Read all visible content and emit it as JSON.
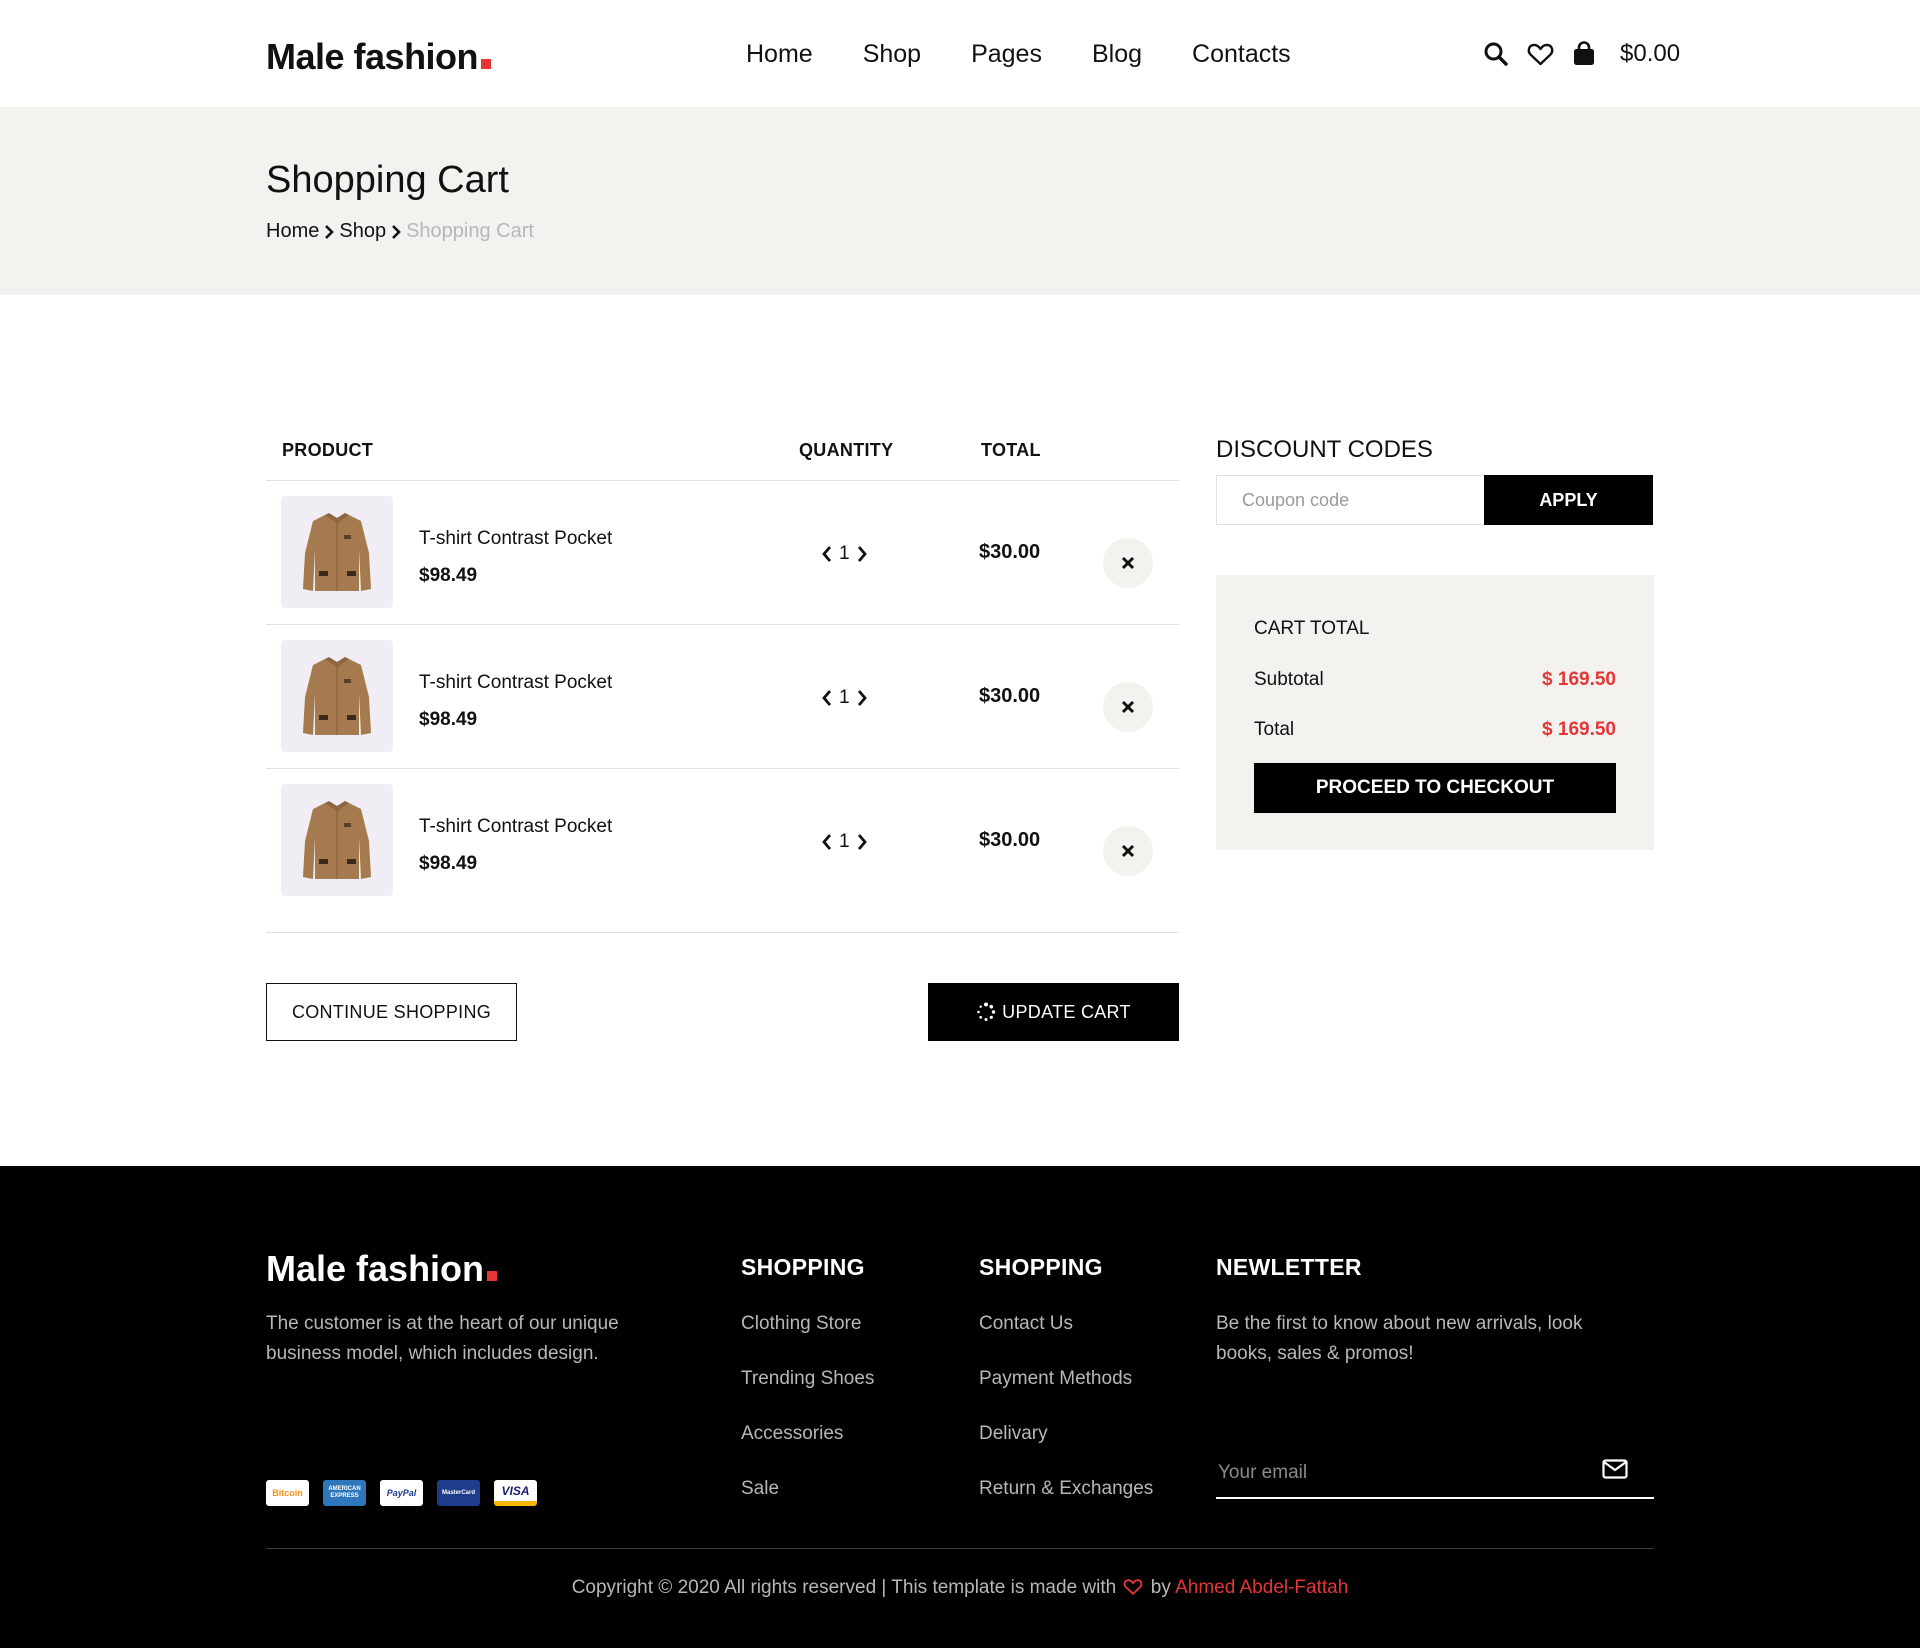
{
  "brand": {
    "name": "Male fashion",
    "accent": "#e53637"
  },
  "nav": {
    "items": [
      "Home",
      "Shop",
      "Pages",
      "Blog",
      "Contacts"
    ]
  },
  "header": {
    "cart_total": "$0.00",
    "icons": [
      "search-icon",
      "heart-icon",
      "shopping-bag-icon"
    ]
  },
  "page": {
    "title": "Shopping Cart",
    "breadcrumb": [
      "Home",
      "Shop",
      "Shopping Cart"
    ]
  },
  "cart": {
    "headers": {
      "product": "PRODUCT",
      "quantity": "QUANTITY",
      "total": "TOTAL"
    },
    "items": [
      {
        "name": "T-shirt Contrast Pocket",
        "price": "$98.49",
        "qty": "1",
        "total": "$30.00"
      },
      {
        "name": "T-shirt Contrast Pocket",
        "price": "$98.49",
        "qty": "1",
        "total": "$30.00"
      },
      {
        "name": "T-shirt Contrast Pocket",
        "price": "$98.49",
        "qty": "1",
        "total": "$30.00"
      }
    ],
    "continue_label": "CONTINUE SHOPPING",
    "update_label": "UPDATE CART"
  },
  "discount": {
    "title": "DISCOUNT CODES",
    "placeholder": "Coupon code",
    "apply_label": "APPLY"
  },
  "totals": {
    "title": "CART TOTAL",
    "subtotal_label": "Subtotal",
    "subtotal_value": "$ 169.50",
    "total_label": "Total",
    "total_value": "$ 169.50",
    "checkout_label": "PROCEED TO CHECKOUT"
  },
  "footer": {
    "logo": "Male fashion",
    "description": "The customer is at the heart of our unique business model, which includes design.",
    "payments": [
      "Bitcoin",
      "AMERICAN EXPRESS",
      "PayPal",
      "MasterCard",
      "VISA"
    ],
    "col1": {
      "title": "SHOPPING",
      "links": [
        "Clothing Store",
        "Trending Shoes",
        "Accessories",
        "Sale"
      ]
    },
    "col2": {
      "title": "SHOPPING",
      "links": [
        "Contact Us",
        "Payment Methods",
        "Delivary",
        "Return & Exchanges"
      ]
    },
    "newsletter": {
      "title": "NEWLETTER",
      "description": "Be the first to know about new arrivals, look books, sales & promos!",
      "placeholder": "Your email"
    },
    "copyright_prefix": "Copyright © 2020 All rights reserved | This template is made with",
    "copyright_by": "by",
    "author": "Ahmed Abdel-Fattah"
  }
}
